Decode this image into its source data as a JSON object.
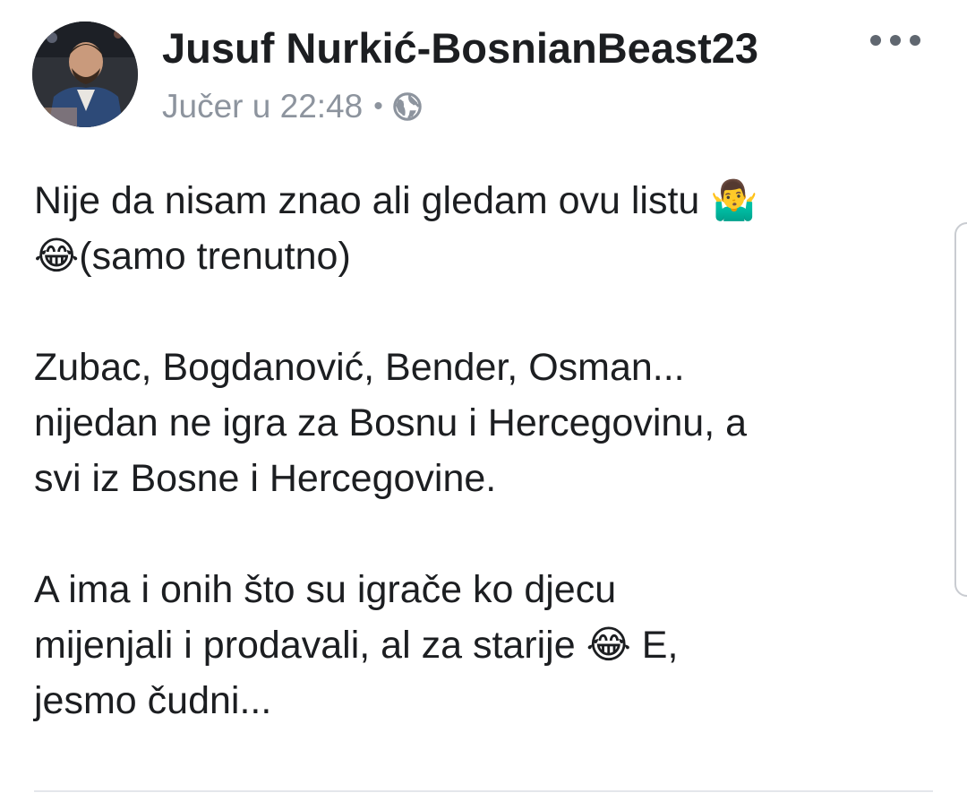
{
  "post": {
    "author": "Jusuf Nurkić-BosnianBeast23",
    "timestamp": "Jučer u 22:48",
    "separator": "•",
    "privacy_icon": "globe-icon",
    "more_icon": "more-options-icon",
    "avatar_icon": "profile-avatar",
    "body": {
      "p1_l1": "Nije da nisam znao ali gledam ovu listu ",
      "p1_emoji1": "🤷‍♂️",
      "p1_emoji2": "😂",
      "p1_l2": "(samo trenutno)",
      "p2_l1": "Zubac, Bogdanović, Bender, Osman...",
      "p2_l2": "nijedan ne igra za Bosnu i Hercegovinu, a",
      "p2_l3": "svi iz Bosne i Hercegovine.",
      "p3_l1": "A ima i onih što su igrače ko djecu",
      "p3_l2": "mijenjali i prodavali, al za starije ",
      "p3_emoji": "😂",
      "p3_l2_end": " E,",
      "p3_l3": "jesmo čudni..."
    }
  },
  "colors": {
    "text": "#1c1e21",
    "meta": "#8d949e",
    "icon": "#606770"
  }
}
